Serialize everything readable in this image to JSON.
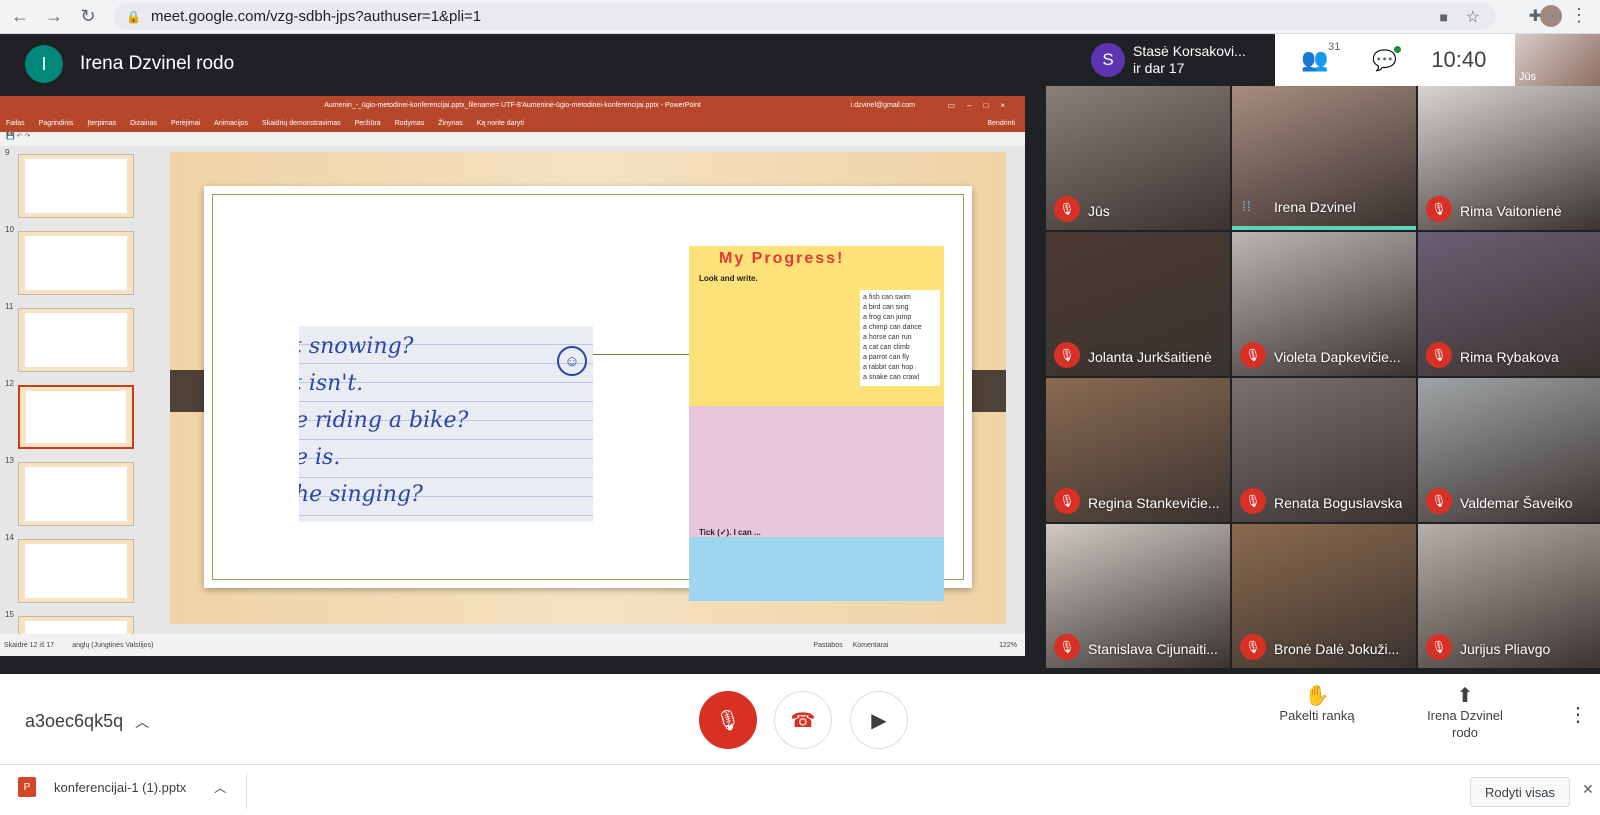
{
  "browser": {
    "url": "meet.google.com/vzg-sdbh-jps?authuser=1&pli=1",
    "back_icon": "arrow-left-icon",
    "forward_icon": "arrow-right-icon",
    "reload_icon": "reload-icon"
  },
  "meet": {
    "presenter_initial": "I",
    "presenter_label": "Irena Dzvinel rodo",
    "speaker_initial": "S",
    "speaker_line1": "Stasė Korsakovi...",
    "speaker_line2": "ir dar 17",
    "participant_count": "31",
    "time": "10:40",
    "self_label": "Jūs"
  },
  "ppt": {
    "title": "Aumenin_-_ūgio-metodinei-konferencijai.pptx_filename= UTF-8'Aumeninė-ūgio-metodinei-konferencijai.pptx - PowerPoint",
    "user_email": "i.dzvinel@gmail.com",
    "ribbon": [
      "Failas",
      "Pagrindinis",
      "Įterpimas",
      "Dizainas",
      "Perėjimai",
      "Animacijos",
      "Skaidrių demonstravimas",
      "Peržiūra",
      "Rodymas",
      "Žinynas",
      "Ką norite daryti"
    ],
    "share": "Bendrinti",
    "thumb_numbers": [
      "9",
      "10",
      "11",
      "12",
      "13",
      "14",
      "15"
    ],
    "status_left": "Skaidrė 12 iš 17",
    "status_lang": "anglų (Jungtinės Valstijos)",
    "status_notes": "Pastabos",
    "status_comments": "Komentarai",
    "zoom": "122%",
    "handwriting": [
      "t snowing?",
      "t isn't.",
      "e riding a bike?",
      "e is.",
      "he singing?"
    ],
    "book_title": "My Progress!",
    "book_look": "Look and write.",
    "book_list": [
      "a fish can swim",
      "a bird can sing",
      "a frog can jump",
      "a chimp can dance",
      "a horse can run",
      "a cat can climb",
      "a parrot can fly",
      "a rabbit can hop",
      "a snake can crawl"
    ],
    "book_tick": "Tick (✓). I can ..."
  },
  "participants": [
    {
      "name": "Jūs",
      "muted": true,
      "color": "#8a8078"
    },
    {
      "name": "Irena Dzvinel",
      "muted": false,
      "color": "#a88c80"
    },
    {
      "name": "Rima Vaitonienė",
      "muted": true,
      "color": "#d8d4d0"
    },
    {
      "name": "Jolanta Jurkšaitienė",
      "muted": true,
      "color": "#4b3a32"
    },
    {
      "name": "Violeta Dapkevičie...",
      "muted": true,
      "color": "#b9b6b4"
    },
    {
      "name": "Rima Rybakova",
      "muted": true,
      "color": "#6b5e73"
    },
    {
      "name": "Regina Stankevičie...",
      "muted": true,
      "color": "#8a6a52"
    },
    {
      "name": "Renata Boguslavska",
      "muted": true,
      "color": "#7a716e"
    },
    {
      "name": "Valdemar Šaveiko",
      "muted": true,
      "color": "#a0a4a6"
    },
    {
      "name": "Stanislava Cijunaiti...",
      "muted": true,
      "color": "#cfcac4"
    },
    {
      "name": "Bronė Dalė Jokuži...",
      "muted": true,
      "color": "#8c6a4e"
    },
    {
      "name": "Jurijus Pliavgo",
      "muted": true,
      "color": "#b7b0a8"
    }
  ],
  "controls": {
    "meeting_code": "a3oec6qk5q",
    "raise_hand": "Pakelti ranką",
    "present_line1": "Irena Dzvinel",
    "present_line2": "rodo"
  },
  "downloads": {
    "file": "konferencijai-1 (1).pptx",
    "file_badge": "P",
    "show_all": "Rodyti visas"
  }
}
